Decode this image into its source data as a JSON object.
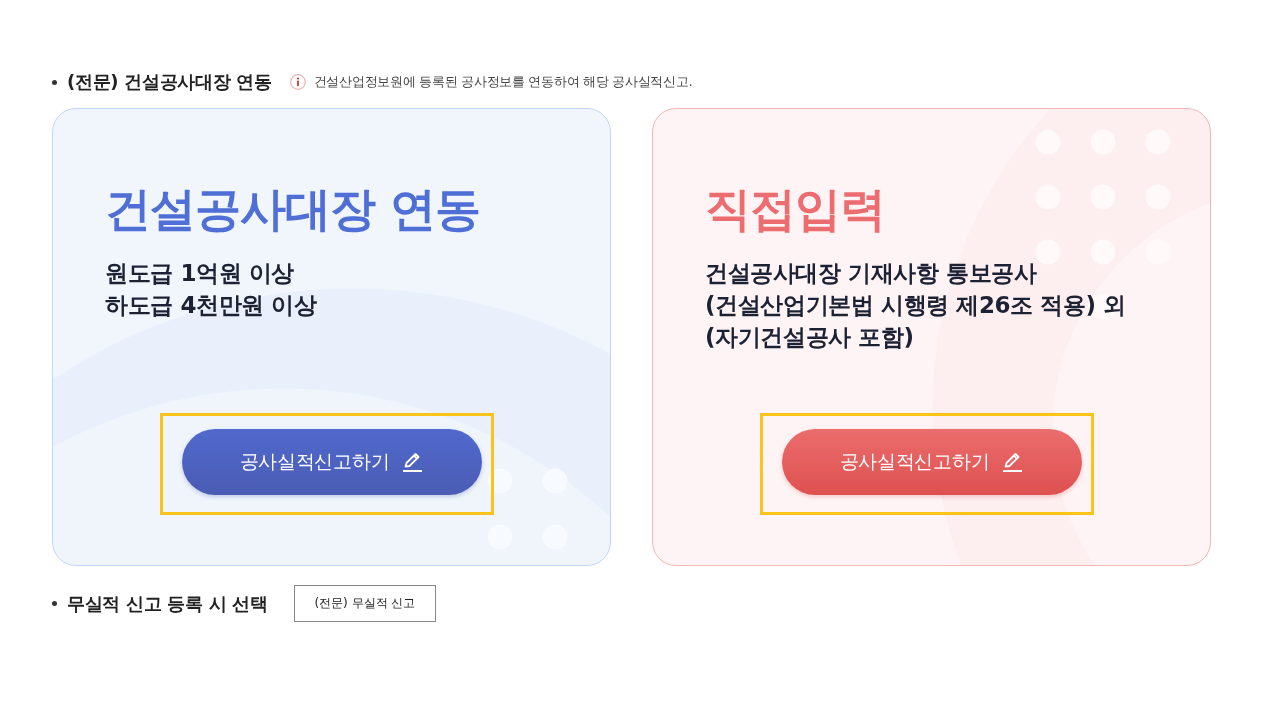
{
  "section": {
    "heading": "(전문) 건설공사대장 연동",
    "note": "건설산업정보원에 등록된 공사정보를 연동하여 해당 공사실적신고."
  },
  "cards": [
    {
      "kind": "linked",
      "title": "건설공사대장 연동",
      "lines": [
        "원도급 1억원 이상",
        "하도급 4천만원 이상"
      ],
      "button": "공사실적신고하기",
      "highlighted": true
    },
    {
      "kind": "direct",
      "title": "직접입력",
      "lines": [
        "건설공사대장 기재사항 통보공사",
        "(건설산업기본법 시행령 제26조 적용) 외",
        "(자기건설공사 포함)"
      ],
      "button": "공사실적신고하기",
      "highlighted": true
    }
  ],
  "no_record": {
    "label": "무실적 신고 등록 시 선택",
    "button": "(전문) 무실적 신고"
  }
}
